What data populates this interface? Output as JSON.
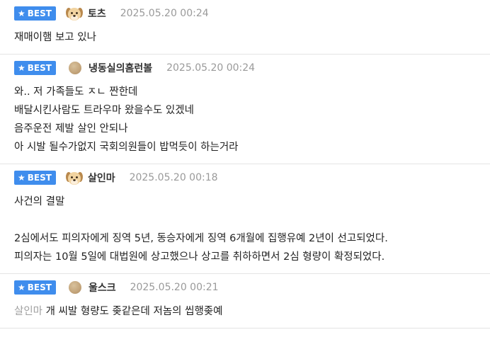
{
  "best_label": "BEST",
  "comments": [
    {
      "avatar": "puppy-avatar",
      "nickname": "토츠",
      "timestamp": "2025.05.20 00:24",
      "lines": [
        "재매이햄 보고 있나"
      ]
    },
    {
      "avatar": "round-dot-avatar",
      "nickname": "냉동실의홈런볼",
      "timestamp": "2025.05.20 00:24",
      "lines": [
        "와.. 저 가족들도 ㅈㄴ 짠한데",
        "배달시킨사람도 트라우마 왔을수도 있겠네",
        "음주운전 제발 살인 안되나",
        "아 시발 될수가없지 국회의원들이 밥먹듯이 하는거라"
      ]
    },
    {
      "avatar": "puppy-avatar",
      "nickname": "살인마",
      "timestamp": "2025.05.20 00:18",
      "lines": [
        "사건의 결말",
        "",
        "2심에서도 피의자에게 징역 5년, 동승자에게 징역 6개월에 집행유예 2년이 선고되었다.",
        "피의자는 10월 5일에 대법원에 상고했으나 상고를 취하하면서 2심 형량이 확정되었다."
      ]
    },
    {
      "avatar": "round-dot-avatar",
      "nickname": "울스크",
      "timestamp": "2025.05.20 00:21",
      "mention": "살인마",
      "lines": [
        "개 씨발 형량도 좆같은데 저놈의 씹행좆예"
      ]
    }
  ]
}
